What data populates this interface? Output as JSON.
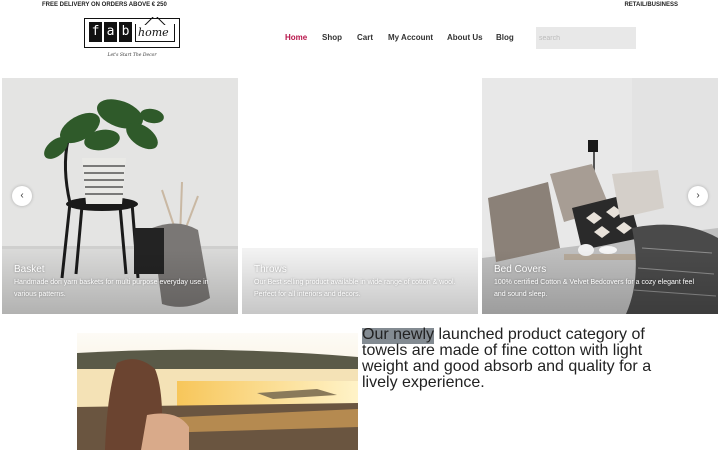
{
  "topbar": {
    "left": "FREE DELIVERY ON ORDERS ABOVE € 250",
    "right": "RETAIL/BUSINESS"
  },
  "logo": {
    "fab_letters": [
      "f",
      "a",
      "b"
    ],
    "home": "home",
    "tagline": "Let's Start The Decor"
  },
  "nav": [
    {
      "label": "Home",
      "active": true
    },
    {
      "label": "Shop"
    },
    {
      "label": "Cart"
    },
    {
      "label": "My Account"
    },
    {
      "label": "About Us"
    },
    {
      "label": "Blog"
    }
  ],
  "search": {
    "placeholder": "search",
    "value": ""
  },
  "slides": [
    {
      "title": "Basket",
      "desc": "Handmade dori yarn baskets for multi purpose everyday use in various patterns."
    },
    {
      "title": "Throws",
      "desc": "Our Best selling product available in wide range of cotton & wool. Perfect for all interiors and decors."
    },
    {
      "title": "Bed Covers",
      "desc": "100% certified Cotton & Velvet Bedcovers for a cozy elegant feel and sound sleep."
    }
  ],
  "slider_controls": {
    "prev_icon": "chevron-left-icon",
    "next_icon": "chevron-right-icon"
  },
  "promo": {
    "text": "Our newly launched product category of towels are made of fine cotton with light weight and good absorb and quality for a lively experience."
  },
  "colors": {
    "accent": "#b8144a",
    "search_bg": "#e8e8e8"
  }
}
